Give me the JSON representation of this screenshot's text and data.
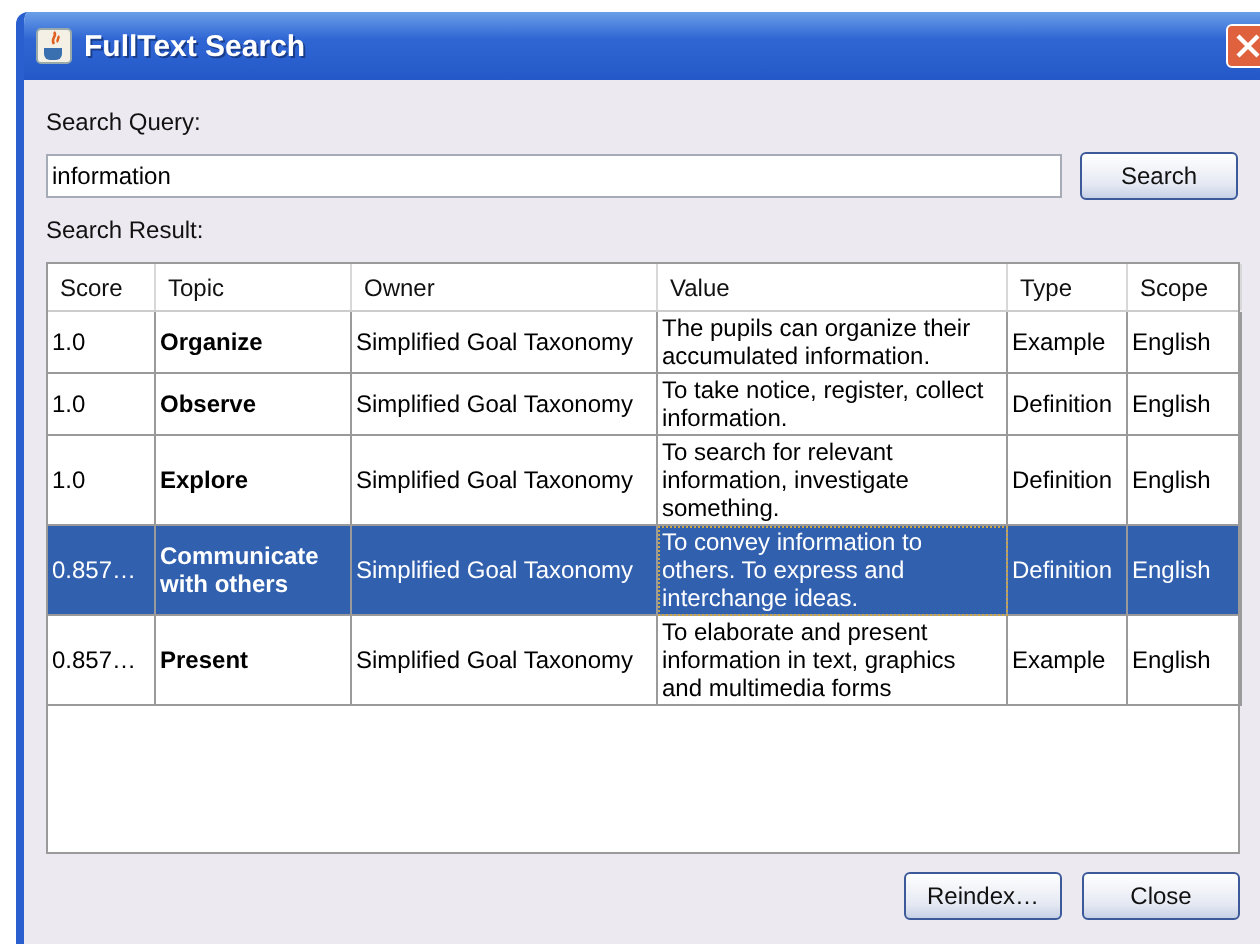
{
  "window": {
    "title": "FullText Search"
  },
  "query": {
    "label": "Search Query:",
    "value": "information",
    "button": "Search"
  },
  "results": {
    "label": "Search Result:",
    "columns": [
      "Score",
      "Topic",
      "Owner",
      "Value",
      "Type",
      "Scope"
    ],
    "rows": [
      {
        "score": "1.0",
        "topic": "Organize",
        "owner": "Simplified Goal Taxonomy",
        "value": "The pupils can organize their accumulated information.",
        "type": "Example",
        "scope": "English",
        "selected": false
      },
      {
        "score": "1.0",
        "topic": "Observe",
        "owner": "Simplified Goal Taxonomy",
        "value": "To take notice, register, collect information.",
        "type": "Definition",
        "scope": "English",
        "selected": false
      },
      {
        "score": "1.0",
        "topic": "Explore",
        "owner": "Simplified Goal Taxonomy",
        "value": "To search for relevant information, investigate something.",
        "type": "Definition",
        "scope": "English",
        "selected": false
      },
      {
        "score": "0.857…",
        "topic": "Communicate with others",
        "owner": "Simplified Goal Taxonomy",
        "value": "To convey information to others. To express and interchange ideas.",
        "type": "Definition",
        "scope": "English",
        "selected": true
      },
      {
        "score": "0.857…",
        "topic": "Present",
        "owner": "Simplified Goal Taxonomy",
        "value": "To elaborate and present information in text, graphics and multimedia forms",
        "type": "Example",
        "scope": "English",
        "selected": false
      }
    ]
  },
  "buttons": [
    "Reindex…",
    "Close"
  ]
}
